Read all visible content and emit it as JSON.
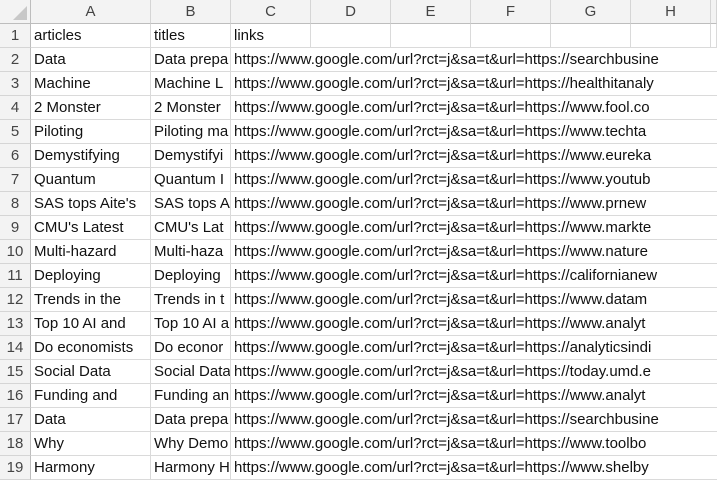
{
  "columns": [
    "A",
    "B",
    "C",
    "D",
    "E",
    "F",
    "G",
    "H"
  ],
  "header_row": {
    "row": "1",
    "articles": "articles",
    "titles": "titles",
    "links": "links"
  },
  "rows": [
    {
      "row": "2",
      "a": "Data",
      "b": "Data prepa",
      "c": "https://www.google.com/url?rct=j&sa=t&url=https://searchbusine"
    },
    {
      "row": "3",
      "a": "Machine",
      "b": "Machine L",
      "c": "https://www.google.com/url?rct=j&sa=t&url=https://healthitanaly"
    },
    {
      "row": "4",
      "a": "2 Monster",
      "b": "2 Monster",
      "c": "https://www.google.com/url?rct=j&sa=t&url=https://www.fool.co"
    },
    {
      "row": "5",
      "a": "Piloting",
      "b": "Piloting ma",
      "c": "https://www.google.com/url?rct=j&sa=t&url=https://www.techta"
    },
    {
      "row": "6",
      "a": "Demystifying",
      "b": "Demystifyi",
      "c": "https://www.google.com/url?rct=j&sa=t&url=https://www.eureka"
    },
    {
      "row": "7",
      "a": "Quantum",
      "b": "Quantum I",
      "c": "https://www.google.com/url?rct=j&sa=t&url=https://www.youtub"
    },
    {
      "row": "8",
      "a": "SAS tops Aite's",
      "b": "SAS tops A",
      "c": "https://www.google.com/url?rct=j&sa=t&url=https://www.prnew"
    },
    {
      "row": "9",
      "a": "CMU's Latest",
      "b": "CMU's Lat",
      "c": "https://www.google.com/url?rct=j&sa=t&url=https://www.markte"
    },
    {
      "row": "10",
      "a": "Multi-hazard",
      "b": "Multi-haza",
      "c": "https://www.google.com/url?rct=j&sa=t&url=https://www.nature"
    },
    {
      "row": "11",
      "a": "Deploying",
      "b": "Deploying",
      "c": "https://www.google.com/url?rct=j&sa=t&url=https://californianew"
    },
    {
      "row": "12",
      "a": "Trends in the",
      "b": "Trends in t",
      "c": "https://www.google.com/url?rct=j&sa=t&url=https://www.datam"
    },
    {
      "row": "13",
      "a": "Top 10 AI and",
      "b": "Top 10 AI a",
      "c": "https://www.google.com/url?rct=j&sa=t&url=https://www.analyt"
    },
    {
      "row": "14",
      "a": "Do economists",
      "b": "Do econor",
      "c": "https://www.google.com/url?rct=j&sa=t&url=https://analyticsindi"
    },
    {
      "row": "15",
      "a": "Social Data",
      "b": "Social Data",
      "c": "https://www.google.com/url?rct=j&sa=t&url=https://today.umd.e"
    },
    {
      "row": "16",
      "a": "Funding and",
      "b": "Funding an",
      "c": "https://www.google.com/url?rct=j&sa=t&url=https://www.analyt"
    },
    {
      "row": "17",
      "a": "Data",
      "b": "Data prepa",
      "c": "https://www.google.com/url?rct=j&sa=t&url=https://searchbusine"
    },
    {
      "row": "18",
      "a": "Why",
      "b": "Why Demo",
      "c": "https://www.google.com/url?rct=j&sa=t&url=https://www.toolbo"
    },
    {
      "row": "19",
      "a": "Harmony",
      "b": "Harmony H",
      "c": "https://www.google.com/url?rct=j&sa=t&url=https://www.shelby"
    }
  ]
}
